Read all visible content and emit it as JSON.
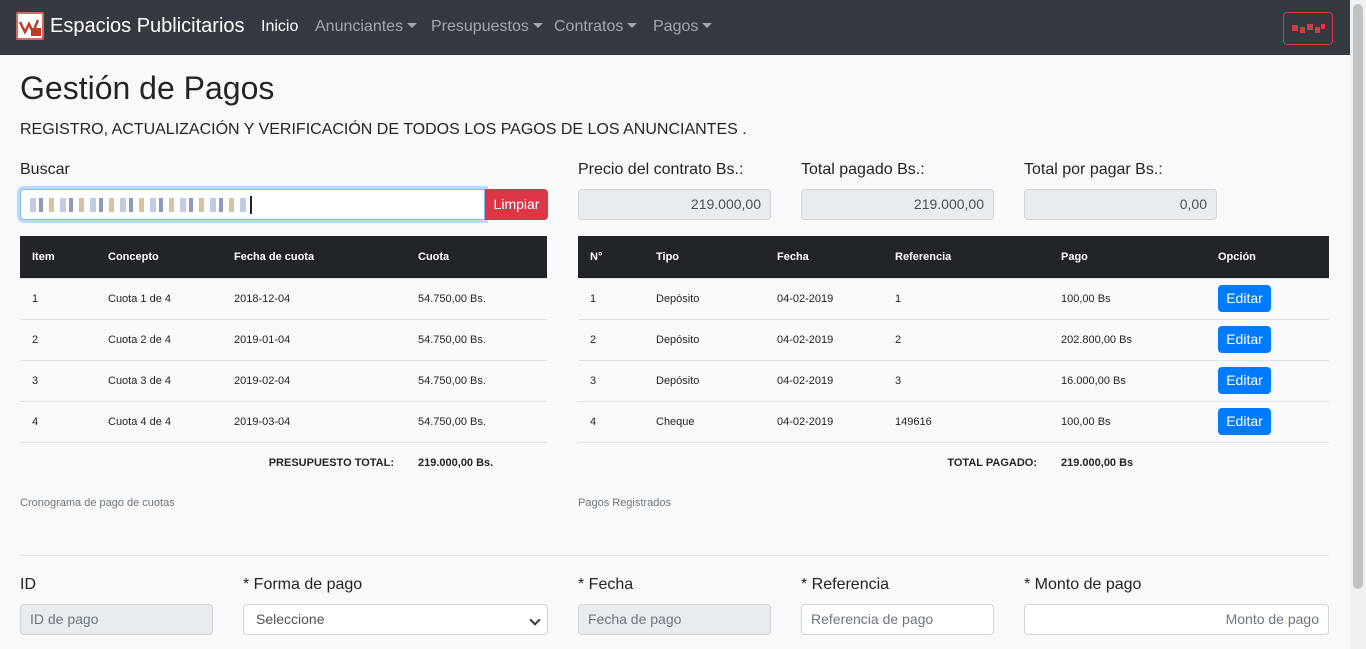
{
  "nav": {
    "brand": "Espacios Publicitarios",
    "items": [
      {
        "label": "Inicio",
        "active": true,
        "dropdown": false
      },
      {
        "label": "Anunciantes",
        "active": false,
        "dropdown": true
      },
      {
        "label": "Presupuestos",
        "active": false,
        "dropdown": true
      },
      {
        "label": "Contratos",
        "active": false,
        "dropdown": true
      },
      {
        "label": "Pagos",
        "active": false,
        "dropdown": true
      }
    ]
  },
  "page": {
    "title": "Gestión de Pagos",
    "lead": "REGISTRO, ACTUALIZACIÓN Y VERIFICACIÓN DE TODOS LOS PAGOS DE LOS ANUNCIANTES ."
  },
  "search": {
    "label": "Buscar",
    "clear_label": "Limpiar"
  },
  "summary": {
    "precio_label": "Precio del contrato Bs.:",
    "precio_value": "219.000,00",
    "pagado_label": "Total pagado Bs.:",
    "pagado_value": "219.000,00",
    "por_pagar_label": "Total por pagar Bs.:",
    "por_pagar_value": "0,00"
  },
  "cuotas": {
    "headers": [
      "Item",
      "Concepto",
      "Fecha de cuota",
      "Cuota"
    ],
    "rows": [
      [
        "1",
        "Cuota 1 de 4",
        "2018-12-04",
        "54.750,00 Bs."
      ],
      [
        "2",
        "Cuota 2 de 4",
        "2019-01-04",
        "54.750,00 Bs."
      ],
      [
        "3",
        "Cuota 3 de 4",
        "2019-02-04",
        "54.750,00 Bs."
      ],
      [
        "4",
        "Cuota 4 de 4",
        "2019-03-04",
        "54.750,00 Bs."
      ]
    ],
    "total_label": "PRESUPUESTO TOTAL:",
    "total_value": "219.000,00 Bs.",
    "caption": "Cronograma de pago de cuotas"
  },
  "pagos": {
    "headers": [
      "N°",
      "Tipo",
      "Fecha",
      "Referencia",
      "Pago",
      "Opción"
    ],
    "rows": [
      [
        "1",
        "Depósito",
        "04-02-2019",
        "1",
        "100,00 Bs"
      ],
      [
        "2",
        "Depósito",
        "04-02-2019",
        "2",
        "202.800,00 Bs"
      ],
      [
        "3",
        "Depósito",
        "04-02-2019",
        "3",
        "16.000,00 Bs"
      ],
      [
        "4",
        "Cheque",
        "04-02-2019",
        "149616",
        "100,00 Bs"
      ]
    ],
    "edit_label": "Editar",
    "total_label": "TOTAL PAGADO:",
    "total_value": "219.000,00 Bs",
    "caption": "Pagos Registrados"
  },
  "form": {
    "id_label": "ID",
    "id_placeholder": "ID de pago",
    "forma_label": "* Forma de pago",
    "forma_value": "Seleccione",
    "fecha_label": "* Fecha",
    "fecha_placeholder": "Fecha de pago",
    "referencia_label": "* Referencia",
    "referencia_placeholder": "Referencia de pago",
    "monto_label": "* Monto de pago",
    "monto_placeholder": "Monto de pago"
  }
}
